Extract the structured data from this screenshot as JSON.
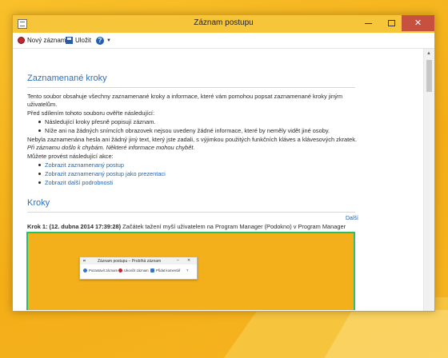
{
  "window": {
    "title": "Záznam postupu",
    "controls": {
      "minimize": "minimize",
      "maximize": "maximize",
      "close": "✕"
    }
  },
  "toolbar": {
    "new_record": "Nový záznam",
    "save": "Uložit",
    "help_icon": "help-icon",
    "help_caret": "▼"
  },
  "content": {
    "section1_title": "Zaznamenané kroky",
    "intro_line1": "Tento soubor obsahuje všechny zaznamenané kroky a informace, které vám pomohou popsat zaznamenané kroky jiným",
    "intro_line2": "uživatelům.",
    "before_share": "Před sdílením tohoto souboru ověřte následující:",
    "check_bullets": [
      "Následující kroky přesně popisují záznam.",
      "Níže ani na žádných snímcích obrazovek nejsou uvedeny žádné informace, které by neměly vidět jiné osoby."
    ],
    "no_password": "Nebyla zaznamenána hesla ani žádný jiný text, který jste zadali, s výjimkou použitých funkčních kláves a klávesových zkratek.",
    "errors_note": "Při záznamu došlo k chybám. Některé informace mohou chybět.",
    "can_do": "Můžete provést následující akce:",
    "action_links": [
      "Zobrazit zaznamenaný postup",
      "Zobrazit zaznamenaný postup jako prezentaci",
      "Zobrazit další podrobnosti"
    ],
    "section2_title": "Kroky",
    "next_link": "Další",
    "step_label": "Krok 1: (12. dubna 2014 17:39:28)",
    "step_text": " Začátek tažení myší uživatelem na Program Manager (Podokno) v Program Manager"
  },
  "screenshot": {
    "title": "Záznam postupu – Probíhá záznam",
    "buttons": [
      "Pozastavit záznam",
      "Ukončit záznam",
      "Přidat komentář"
    ],
    "help_glyph": "?"
  },
  "colors": {
    "accent_blue": "#2f6fb6",
    "link_blue": "#1f63b6",
    "titlebar": "#f6c53a",
    "close_red": "#c7503f",
    "desktop": "#f6b520",
    "screenshot_border": "#2bbf6a"
  }
}
